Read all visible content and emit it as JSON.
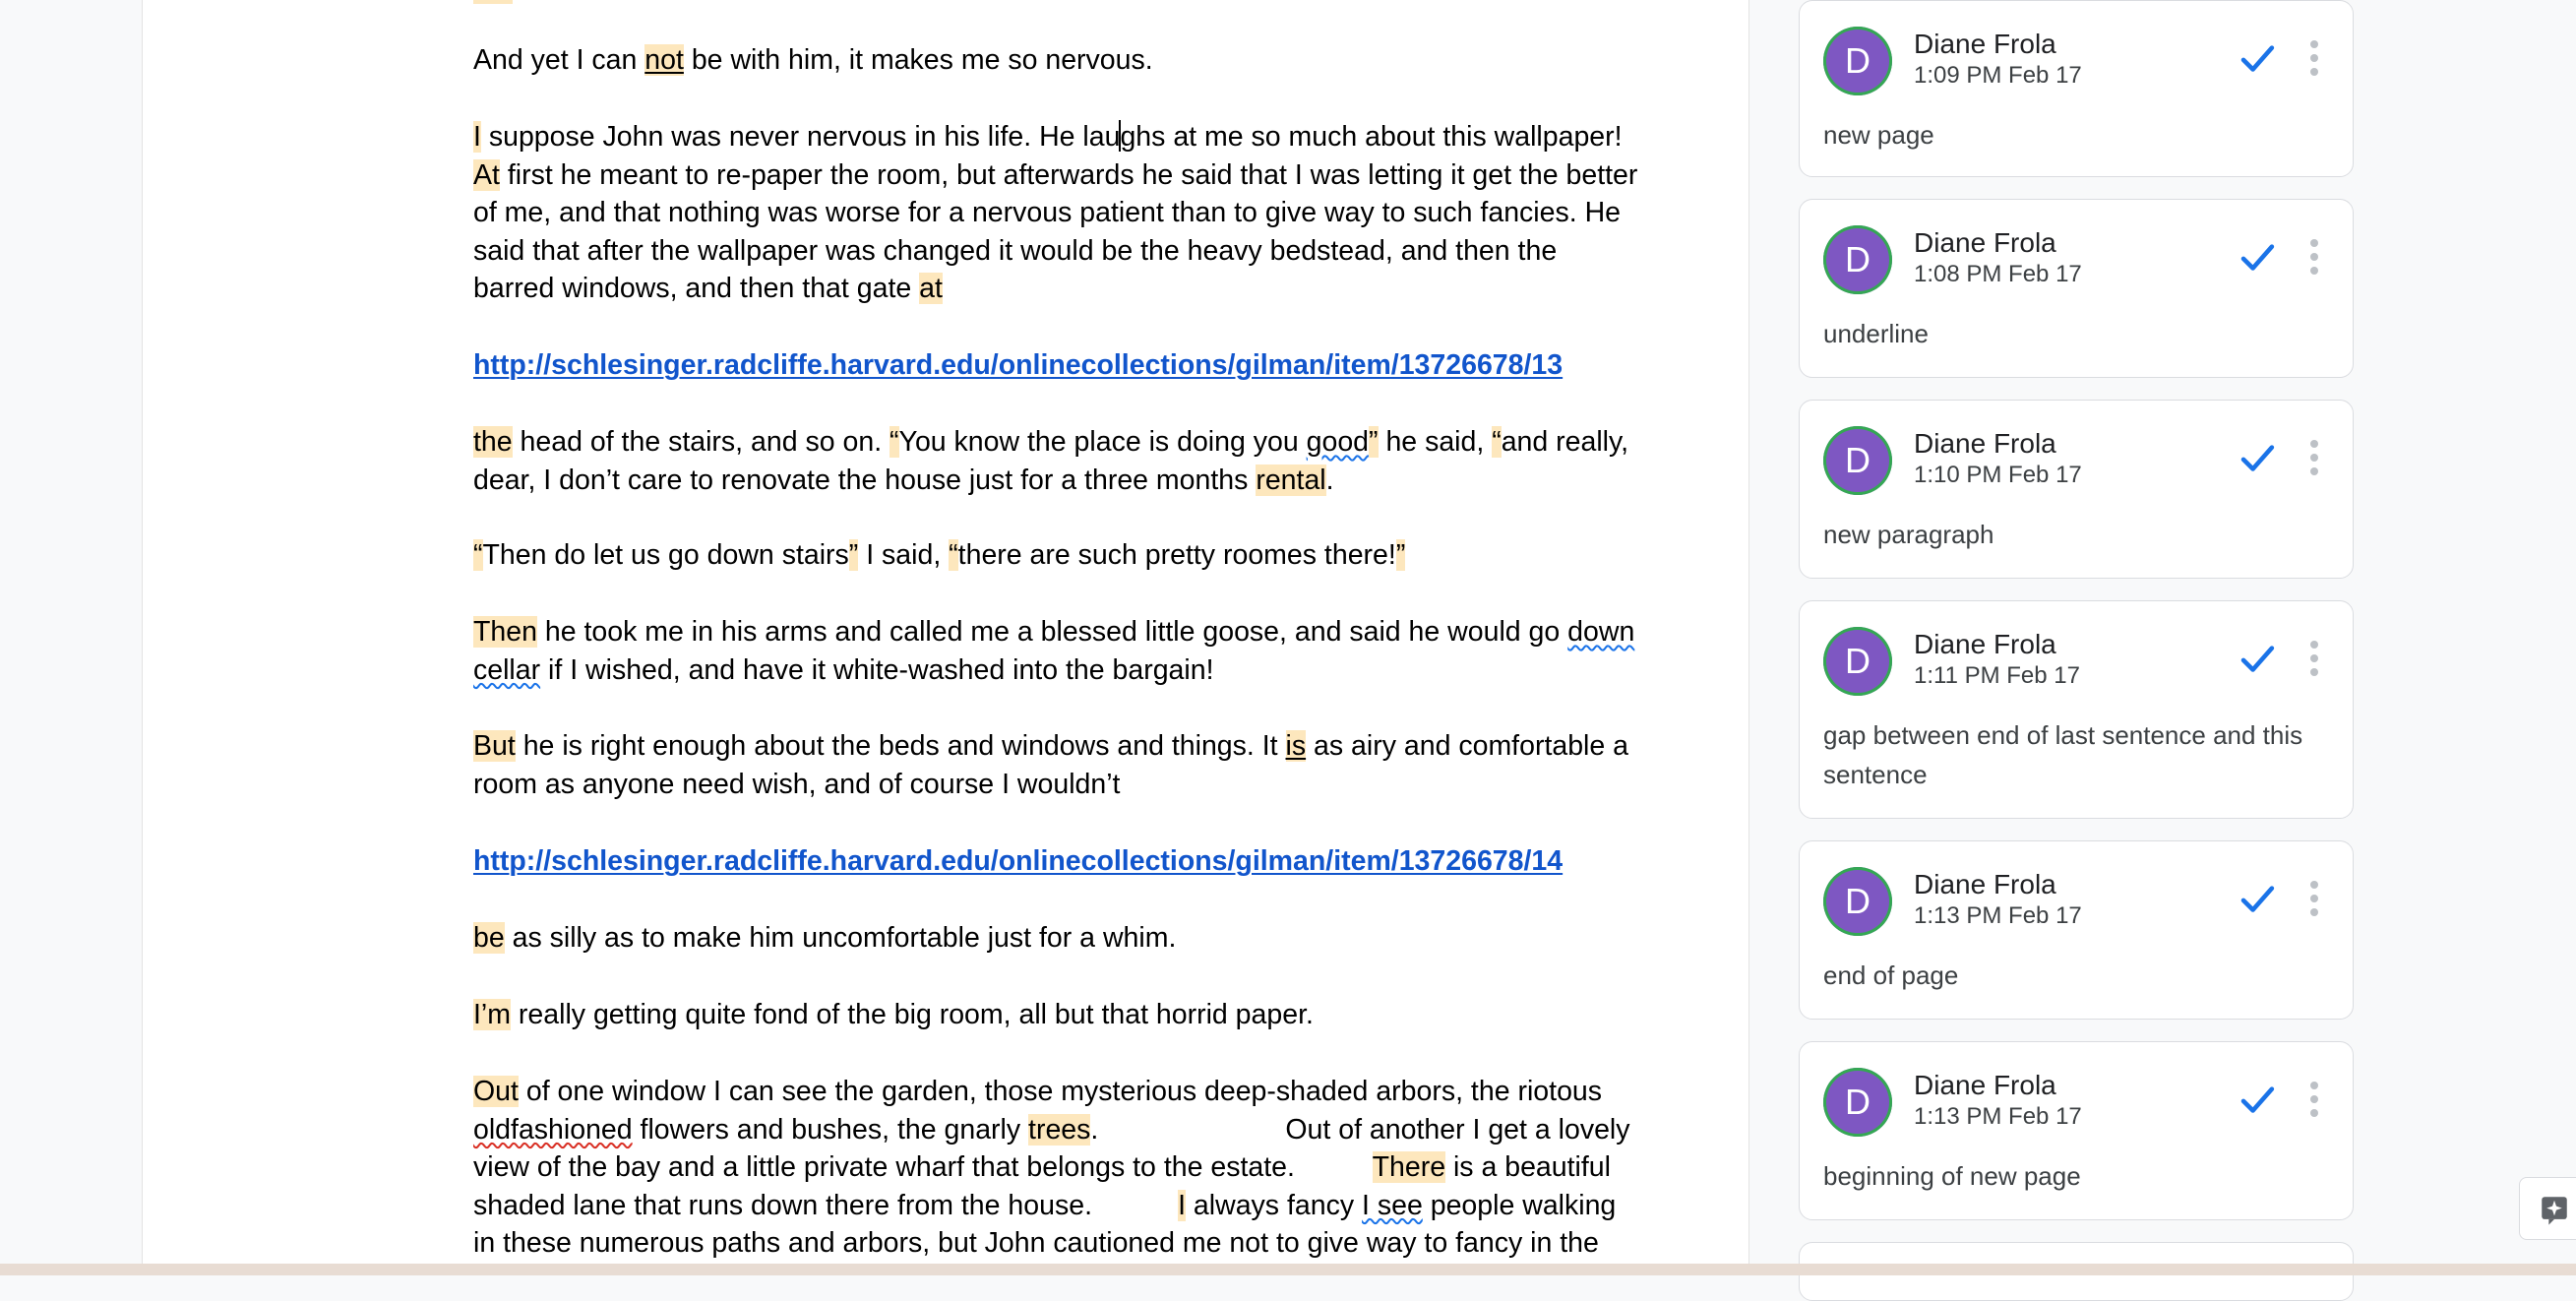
{
  "document": {
    "paragraphs": [
      {
        "id": "p1",
        "lines": [
          [
            {
              "t": "And yet I can "
            },
            {
              "t": "not",
              "hl": 1,
              "ul": 1
            },
            {
              "t": " be with him, it makes me so nervous."
            }
          ]
        ]
      },
      {
        "id": "p2",
        "lines": [
          [
            {
              "t": "I",
              "hl": 1
            },
            {
              "t": " suppose John was never nervous in his life. He lau"
            },
            {
              "caret": 1
            },
            {
              "t": "ghs at me so much about this wallpaper!"
            }
          ],
          [
            {
              "t": "At",
              "hl": 1
            },
            {
              "t": " first he meant to re-paper the room, but afterwards he said that I was letting it get the better"
            }
          ],
          [
            {
              "t": "of me, and that nothing was worse for a nervous patient than to give way to such fancies. He"
            }
          ],
          [
            {
              "t": "said that after the wallpaper was changed it would be the heavy bedstead, and then the"
            }
          ],
          [
            {
              "t": "barred windows, and then that gate "
            },
            {
              "t": "at",
              "hl": 1
            }
          ]
        ]
      },
      {
        "id": "link1",
        "link": "http://schlesinger.radcliffe.harvard.edu/onlinecollections/gilman/item/13726678/13"
      },
      {
        "id": "p3",
        "lines": [
          [
            {
              "t": "the",
              "hl": 1
            },
            {
              "t": " head of the stairs, and so on. "
            },
            {
              "t": "“",
              "hl": 1
            },
            {
              "t": "You know the place is doing you "
            },
            {
              "t": "good",
              "gram": 1
            },
            {
              "t": "”",
              "hl": 1
            },
            {
              "t": " he said, "
            },
            {
              "t": "“",
              "hl": 1
            },
            {
              "t": "and really,"
            }
          ],
          [
            {
              "t": "dear, I don’t care to renovate the house just for a three months "
            },
            {
              "t": "rental",
              "hl": 1
            },
            {
              "t": "."
            }
          ]
        ]
      },
      {
        "id": "p4",
        "lines": [
          [
            {
              "t": "“",
              "hl": 1
            },
            {
              "t": "Then do let us go down stairs"
            },
            {
              "t": "”",
              "hl": 1
            },
            {
              "t": " I said, "
            },
            {
              "t": "“",
              "hl": 1
            },
            {
              "t": "there are such pretty roomes there!"
            },
            {
              "t": "”",
              "hl": 1
            }
          ]
        ]
      },
      {
        "id": "p5",
        "lines": [
          [
            {
              "t": "Then",
              "hl": 1
            },
            {
              "t": " he took me in his arms and called me a blessed little goose, and said he would go "
            },
            {
              "t": "down",
              "gram": 1
            }
          ],
          [
            {
              "t": "cellar",
              "gram": 1
            },
            {
              "t": " if I wished, and have it white-washed into the bargain!"
            }
          ]
        ]
      },
      {
        "id": "p6",
        "lines": [
          [
            {
              "t": "But",
              "hl": 1
            },
            {
              "t": " he is right enough about the beds and windows and things. It "
            },
            {
              "t": "is",
              "hl": 1,
              "ul": 1
            },
            {
              "t": " as airy and comfortable a"
            }
          ],
          [
            {
              "t": "room as anyone need wish, and of course I wouldn’t"
            }
          ]
        ]
      },
      {
        "id": "link2",
        "link": "http://schlesinger.radcliffe.harvard.edu/onlinecollections/gilman/item/13726678/14"
      },
      {
        "id": "p7",
        "lines": [
          [
            {
              "t": "be",
              "hl": 1
            },
            {
              "t": " as silly as to make him uncomfortable just for a whim."
            }
          ]
        ]
      },
      {
        "id": "p8",
        "lines": [
          [
            {
              "t": "I’m",
              "hl": 1
            },
            {
              "t": " really getting quite fond of the big room, all but that horrid paper."
            }
          ]
        ]
      },
      {
        "id": "p9",
        "lines": [
          [
            {
              "t": "Out",
              "hl": 1
            },
            {
              "t": " of one window I can see the garden, those mysterious deep-shaded arbors, the riotous"
            }
          ],
          [
            {
              "t": "oldfashioned",
              "spell": 1
            },
            {
              "t": " flowers and bushes, the gnarly "
            },
            {
              "t": "trees",
              "hl": 1
            },
            {
              "t": ".                        Out of another I get a lovely"
            }
          ],
          [
            {
              "t": "view of the bay and a little private wharf that belongs to the estate.          "
            },
            {
              "t": "There",
              "hl": 1
            },
            {
              "t": " is a beautiful"
            }
          ],
          [
            {
              "t": "shaded lane that runs down there from the house.           "
            },
            {
              "t": "I",
              "hl": 1
            },
            {
              "t": " always fancy "
            },
            {
              "t": "I see",
              "gram": 1
            },
            {
              "t": " people walking"
            }
          ],
          [
            {
              "t": "in these numerous paths and arbors, but John cautioned me not to give way to fancy in the"
            }
          ]
        ]
      }
    ]
  },
  "comments": [
    {
      "initial": "D",
      "author": "Diane Frola",
      "time": "1:09 PM Feb 17",
      "text": "new page"
    },
    {
      "initial": "D",
      "author": "Diane Frola",
      "time": "1:08 PM Feb 17",
      "text": "underline"
    },
    {
      "initial": "D",
      "author": "Diane Frola",
      "time": "1:10 PM Feb 17",
      "text": "new paragraph"
    },
    {
      "initial": "D",
      "author": "Diane Frola",
      "time": "1:11 PM Feb 17",
      "text": "gap between end of last sentence and this sentence"
    },
    {
      "initial": "D",
      "author": "Diane Frola",
      "time": "1:13 PM Feb 17",
      "text": "end of page"
    },
    {
      "initial": "D",
      "author": "Diane Frola",
      "time": "1:13 PM Feb 17",
      "text": "beginning of new page"
    }
  ],
  "colors": {
    "highlight": "#fde7bd",
    "link": "#1155cc",
    "avatar": "#7e57c2",
    "avatar_ring": "#34a853",
    "resolve_check": "#1a73e8"
  },
  "icons": {
    "resolve": "check-icon",
    "more": "more-vertical-icon",
    "assist": "sparkle-icon"
  }
}
